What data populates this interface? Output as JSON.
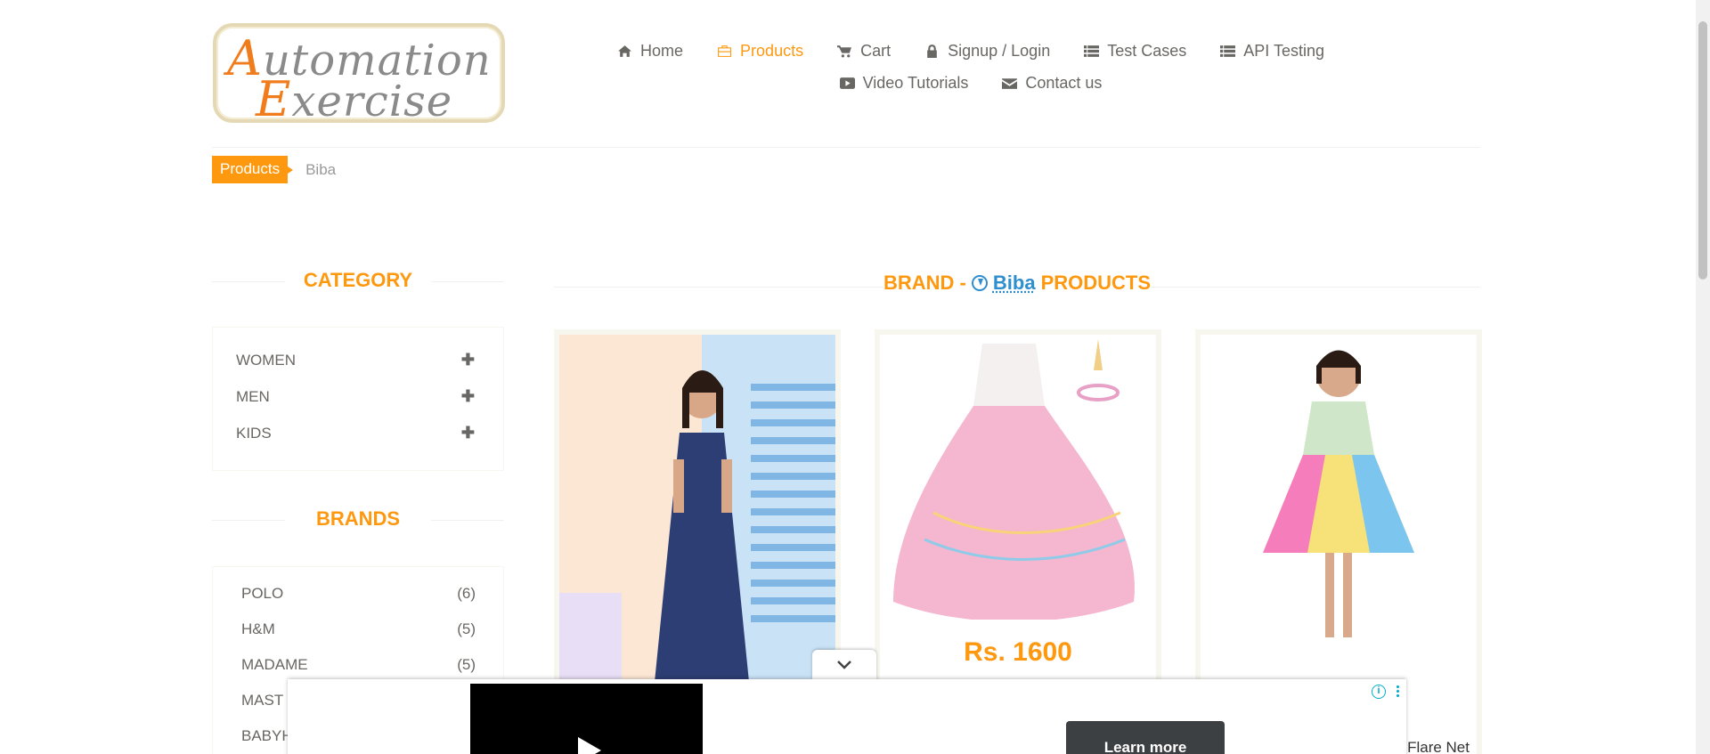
{
  "logo": {
    "line1_cap": "A",
    "line1_rest": "utomation",
    "line2_cap": "E",
    "line2_rest": "xercise"
  },
  "nav": {
    "items": [
      {
        "label": "Home",
        "icon": "home-icon"
      },
      {
        "label": "Products",
        "icon": "briefcase-icon",
        "active": true
      },
      {
        "label": "Cart",
        "icon": "cart-icon"
      },
      {
        "label": "Signup / Login",
        "icon": "lock-icon"
      },
      {
        "label": "Test Cases",
        "icon": "list-icon"
      },
      {
        "label": "API Testing",
        "icon": "list-icon"
      },
      {
        "label": "Video Tutorials",
        "icon": "youtube-icon"
      },
      {
        "label": "Contact us",
        "icon": "envelope-icon"
      }
    ]
  },
  "breadcrumb": {
    "parent": "Products",
    "current": "Biba"
  },
  "sidebar": {
    "category_title": "CATEGORY",
    "categories": [
      "WOMEN",
      "MEN",
      "KIDS"
    ],
    "brands_title": "BRANDS",
    "brands": [
      {
        "name": "POLO",
        "count": "(6)"
      },
      {
        "name": "H&M",
        "count": "(5)"
      },
      {
        "name": "MADAME",
        "count": "(5)"
      },
      {
        "name": "MAST",
        "count": ""
      },
      {
        "name": "BABYH",
        "count": ""
      }
    ]
  },
  "main": {
    "title_prefix": "BRAND -",
    "title_brand": "Biba",
    "title_suffix": "PRODUCTS",
    "products": [
      {
        "price": "",
        "name": ""
      },
      {
        "price": "Rs. 1600",
        "name": ""
      },
      {
        "price": "",
        "name": "Flare Net"
      }
    ]
  },
  "ad": {
    "button_label": "Learn more",
    "info": "i"
  },
  "colors": {
    "accent": "#fe980f",
    "link": "#2e8ece",
    "text": "#696763"
  }
}
